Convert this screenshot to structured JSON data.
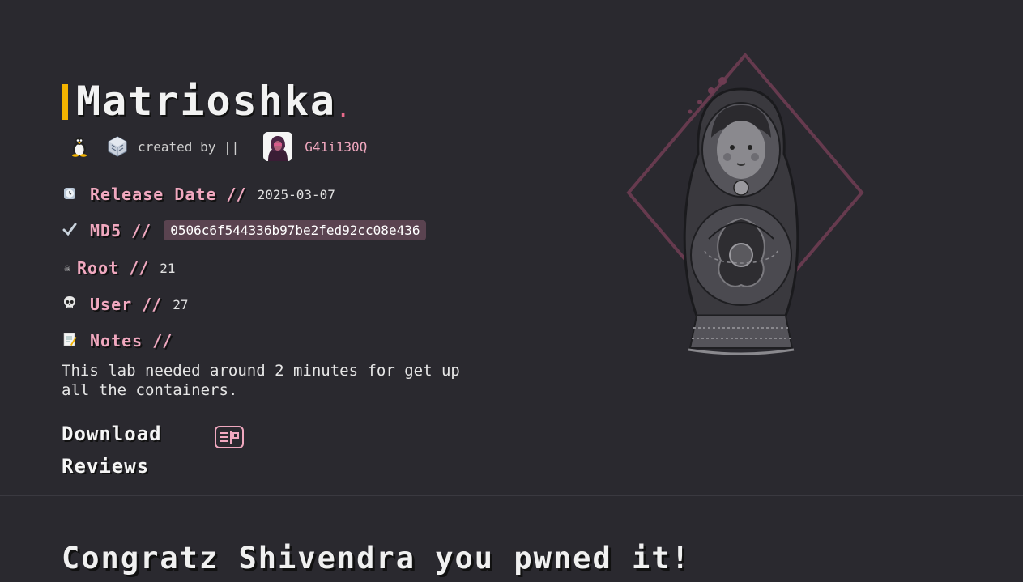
{
  "machine": {
    "title": "Matrioshka",
    "title_dot": ".",
    "os_icon": "linux-penguin-icon",
    "platform_icon": "virtualbox-icon",
    "created_by": "created by ||",
    "author": "G41i130Q",
    "accent_color": "#f4b400",
    "label_color": "#f0a8bf"
  },
  "fields": {
    "release_date": {
      "icon": "clock-icon",
      "label": "Release Date",
      "sep": "//",
      "value": "2025-03-07"
    },
    "md5": {
      "icon": "check-icon",
      "label": "MD5",
      "sep": "//",
      "value": "0506c6f544336b97be2fed92cc08e436"
    },
    "root": {
      "icon": "skull-crossbones-icon",
      "label": "Root",
      "sep": "//",
      "value": "21"
    },
    "user": {
      "icon": "skull-icon",
      "label": "User",
      "sep": "//",
      "value": "27"
    },
    "notes": {
      "icon": "memo-icon",
      "label": "Notes",
      "sep": "//",
      "value": "This lab needed around 2 minutes for get up all the containers."
    }
  },
  "links": {
    "download": "Download",
    "reviews": "Reviews"
  },
  "congrats": "Congratz Shivendra you pwned it!"
}
